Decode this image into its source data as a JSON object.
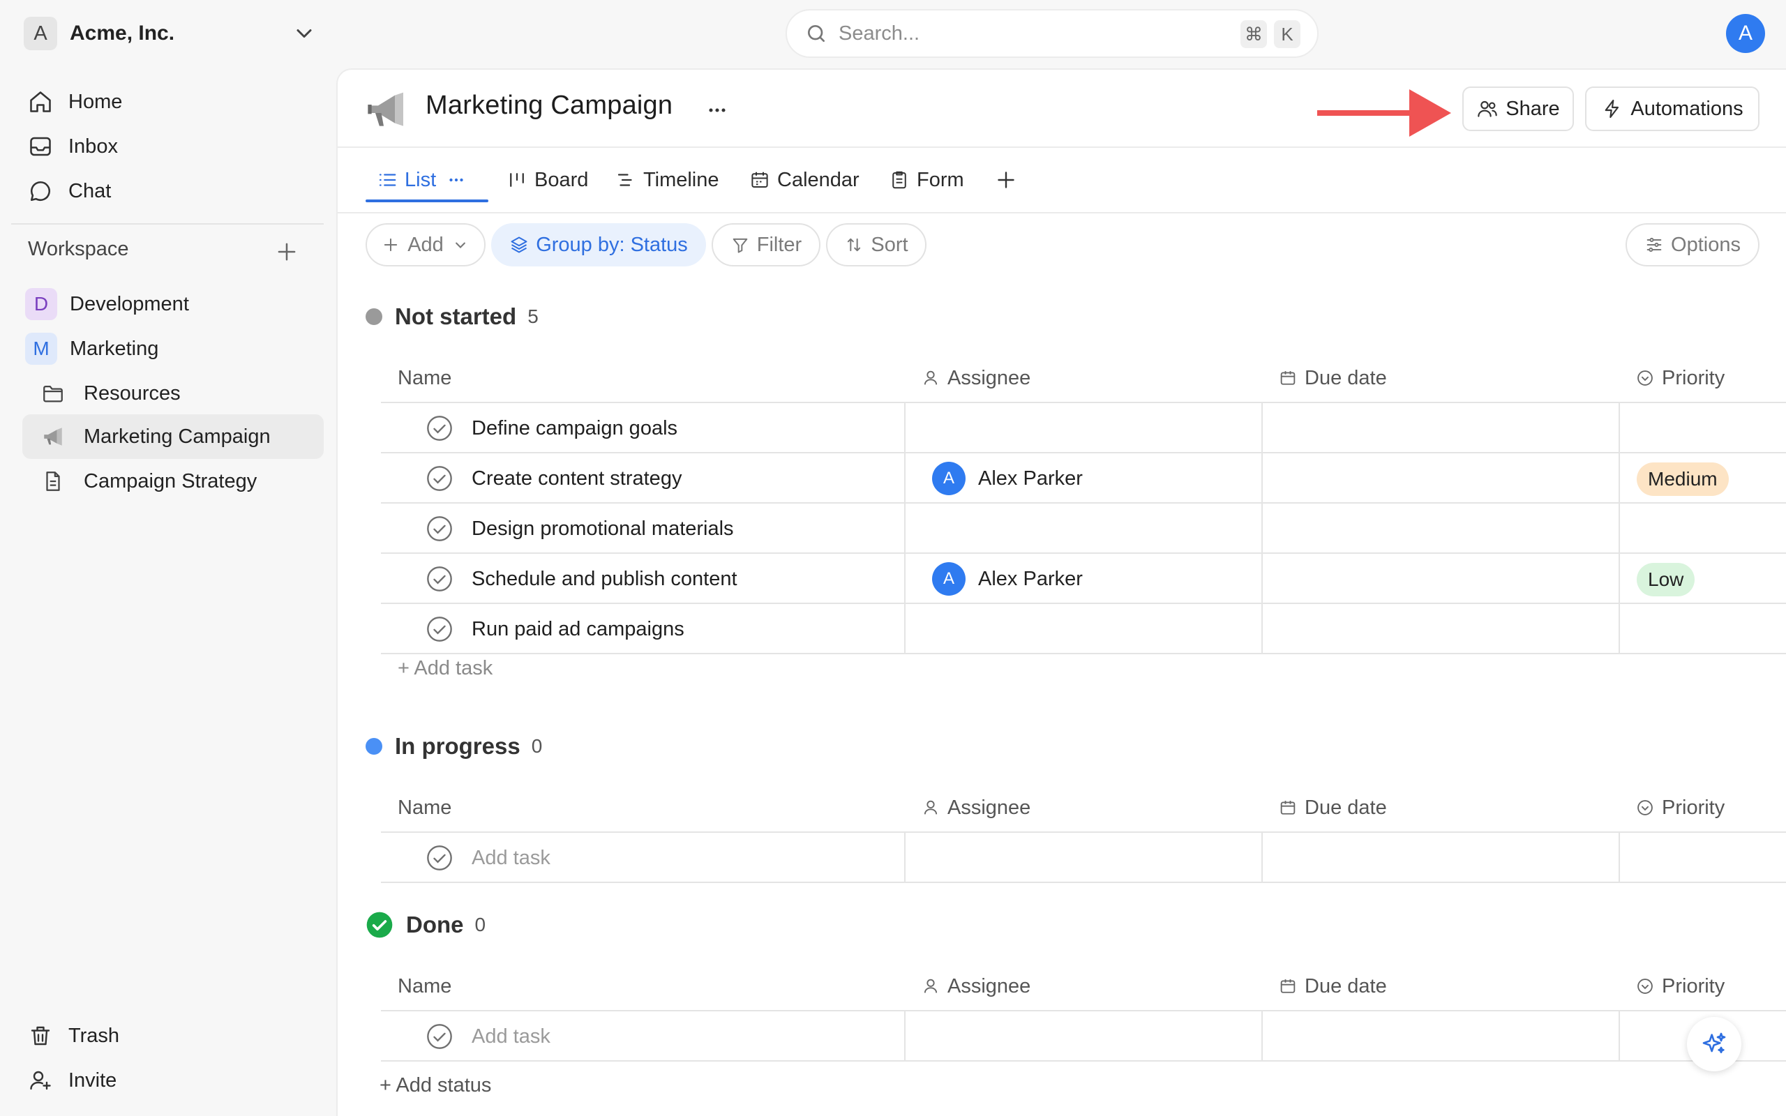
{
  "workspace_switcher": {
    "initial": "A",
    "name": "Acme, Inc."
  },
  "search": {
    "placeholder": "Search...",
    "shortcut_mod": "⌘",
    "shortcut_key": "K"
  },
  "user": {
    "initial": "A"
  },
  "sidebar": {
    "nav": [
      {
        "label": "Home",
        "icon": "home-icon"
      },
      {
        "label": "Inbox",
        "icon": "inbox-icon"
      },
      {
        "label": "Chat",
        "icon": "chat-icon"
      }
    ],
    "workspace_label": "Workspace",
    "spaces": [
      {
        "initial": "D",
        "label": "Development",
        "color": "#eadcf7",
        "text_color": "#7a3fbf"
      },
      {
        "initial": "M",
        "label": "Marketing",
        "color": "#dfe9fb",
        "text_color": "#2f6fe0"
      }
    ],
    "items": [
      {
        "label": "Resources",
        "icon": "folder-icon"
      },
      {
        "label": "Marketing Campaign",
        "icon": "megaphone-icon",
        "active": true
      },
      {
        "label": "Campaign Strategy",
        "icon": "document-icon"
      }
    ],
    "bottom": [
      {
        "label": "Trash",
        "icon": "trash-icon"
      },
      {
        "label": "Invite",
        "icon": "invite-icon"
      }
    ]
  },
  "page": {
    "title": "Marketing Campaign",
    "share_label": "Share",
    "automations_label": "Automations"
  },
  "views": {
    "tabs": [
      {
        "label": "List",
        "icon": "list-icon",
        "active": true
      },
      {
        "label": "Board",
        "icon": "board-icon"
      },
      {
        "label": "Timeline",
        "icon": "timeline-icon"
      },
      {
        "label": "Calendar",
        "icon": "calendar-icon"
      },
      {
        "label": "Form",
        "icon": "form-icon"
      }
    ]
  },
  "toolbar": {
    "add_label": "Add",
    "group_label": "Group by: Status",
    "filter_label": "Filter",
    "sort_label": "Sort",
    "options_label": "Options"
  },
  "columns": {
    "name": "Name",
    "assignee": "Assignee",
    "due_date": "Due date",
    "priority": "Priority"
  },
  "groups": [
    {
      "title": "Not started",
      "count": "5",
      "color": "#9a9a9a",
      "tasks": [
        {
          "name": "Define campaign goals",
          "assignee": "",
          "priority": ""
        },
        {
          "name": "Create content strategy",
          "assignee": "Alex Parker",
          "assignee_initial": "A",
          "priority": "Medium",
          "priority_color": "#fde4c5"
        },
        {
          "name": "Design promotional materials",
          "assignee": "",
          "priority": ""
        },
        {
          "name": "Schedule and publish content",
          "assignee": "Alex Parker",
          "assignee_initial": "A",
          "priority": "Low",
          "priority_color": "#d9f4dd"
        },
        {
          "name": "Run paid ad campaigns",
          "assignee": "",
          "priority": ""
        }
      ],
      "add_task_label": "+ Add task"
    },
    {
      "title": "In progress",
      "count": "0",
      "color": "#4a90f5",
      "placeholder_row": "Add task"
    },
    {
      "title": "Done",
      "count": "0",
      "color": "#1aaa4a",
      "placeholder_row": "Add task"
    }
  ],
  "add_status_label": "+ Add status"
}
